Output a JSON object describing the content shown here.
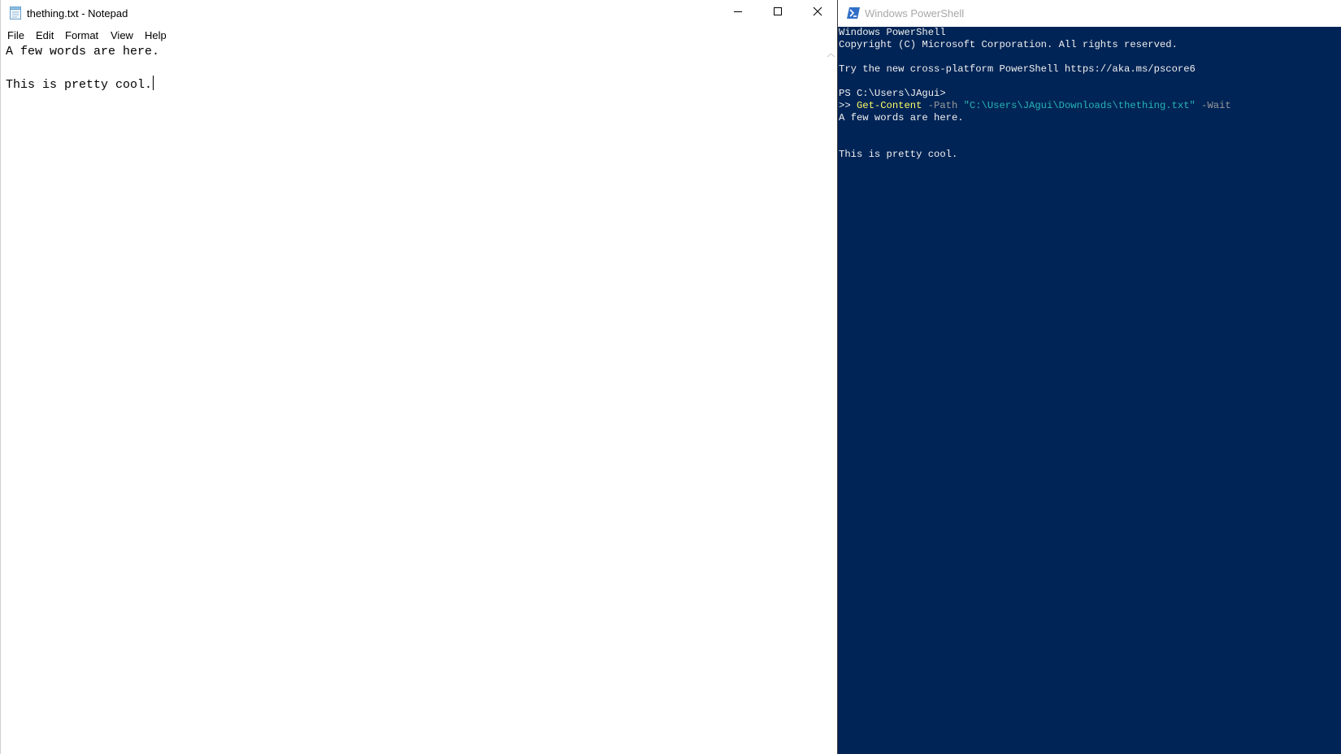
{
  "notepad": {
    "title": "thething.txt - Notepad",
    "app_icon": "notepad-icon",
    "window_buttons": [
      "minimize-icon",
      "maximize-icon",
      "close-icon"
    ],
    "menu": [
      "File",
      "Edit",
      "Format",
      "View",
      "Help"
    ],
    "lines": [
      "A few words are here.",
      "",
      "This is pretty cool."
    ]
  },
  "powershell": {
    "title": "Windows PowerShell",
    "app_icon": "powershell-icon",
    "lines": [
      "Windows PowerShell",
      "Copyright (C) Microsoft Corporation. All rights reserved.",
      "",
      "Try the new cross-platform PowerShell https://aka.ms/pscore6",
      "",
      "PS C:\\Users\\JAgui>"
    ],
    "command": {
      "prompt": ">> ",
      "cmdlet": "Get-Content",
      "param_path": " -Path ",
      "path_value": "\"C:\\Users\\JAgui\\Downloads\\thething.txt\"",
      "param_wait": " -Wait"
    },
    "output": [
      "A few words are here.",
      "",
      "",
      "This is pretty cool."
    ]
  },
  "colors": {
    "powershell_background": "#012456",
    "cmdlet": "#ffff66",
    "string": "#26b5b5",
    "parameter": "#9a9a9a"
  }
}
